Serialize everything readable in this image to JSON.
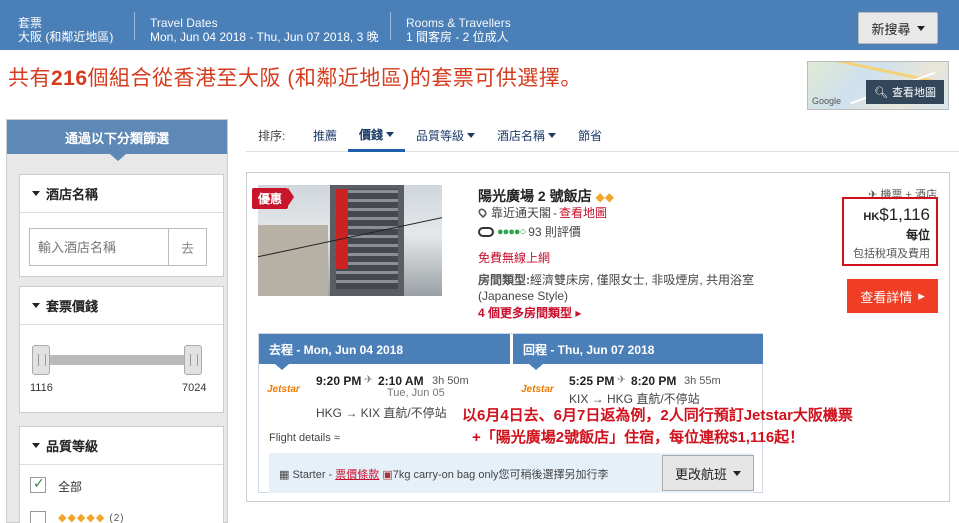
{
  "topbar": {
    "package_label": "套票",
    "destination": "大阪 (和鄰近地區)",
    "dates_label": "Travel Dates",
    "dates_value": "Mon, Jun 04 2018 - Thu, Jun 07 2018, 3 晚",
    "rooms_label": "Rooms & Travellers",
    "rooms_value": "1 間客房 - 2 位成人",
    "new_search": "新搜尋"
  },
  "headline": {
    "prefix": "共有",
    "count": "216",
    "suffix": "個組合從香港至大阪 (和鄰近地區)的套票可供選擇。"
  },
  "map": {
    "google": "Google",
    "button": "查看地圖"
  },
  "sidebar": {
    "title": "通過以下分類篩選",
    "hotel_name_title": "酒店名稱",
    "hotel_name_placeholder": "輸入酒店名稱",
    "go": "去",
    "price_title": "套票價錢",
    "price_min": "1116",
    "price_max": "7024",
    "quality_title": "品質等級",
    "quality_all": "全部",
    "quality_4_count": "(2)",
    "quality_4_diamonds": "◆◆◆◆◆"
  },
  "sort": {
    "label": "排序:",
    "items": [
      "推薦",
      "價錢",
      "品質等級",
      "酒店名稱",
      "節省"
    ]
  },
  "card": {
    "badge": "優惠",
    "hotel_name": "陽光廣場 2 號飯店",
    "hotel_diamonds": "◆◆",
    "location": "靠近通天閣",
    "map_link": "查看地圖",
    "reviews": "93 則評價",
    "wifi": "免費無線上網",
    "room_type_label": "房間類型:",
    "room_type_value": "經濟雙床房, 僅限女士, 非吸煙房, 共用浴室 (Japanese Style)",
    "more_rooms": "4 個更多房間類型",
    "package_label": "機票 + 酒店",
    "price_currency": "HK",
    "price_value": "$1,116",
    "per_person": "每位",
    "incl_taxes": "包括稅項及費用",
    "details_button": "查看詳情"
  },
  "flight": {
    "outbound_head": "去程 - Mon, Jun 04 2018",
    "return_head": "回程 - Thu, Jun 07 2018",
    "airline": "Jetstar",
    "out_dep": "9:20 PM",
    "out_arr": "2:10 AM",
    "out_dur": "3h 50m",
    "out_arr_date": "Tue, Jun 05",
    "out_route": "HKG → KIX  直航/不停站",
    "ret_dep": "5:25 PM",
    "ret_arr": "8:20 PM",
    "ret_dur": "3h 55m",
    "ret_route": "KIX → HKG  直航/不停站",
    "details_link": "Flight details",
    "fare_starter": "Starter -",
    "fare_rules": "票價條款",
    "fare_bag": "7kg carry-on bag only您可稍後選擇另加行李",
    "change_button": "更改航班"
  },
  "annotation": {
    "line1": "以6月4日去、6月7日返為例，2人同行預訂Jetstar大阪機票",
    "line2": "+「陽光廣場2號飯店」住宿，每位連稅$1,116起！"
  }
}
